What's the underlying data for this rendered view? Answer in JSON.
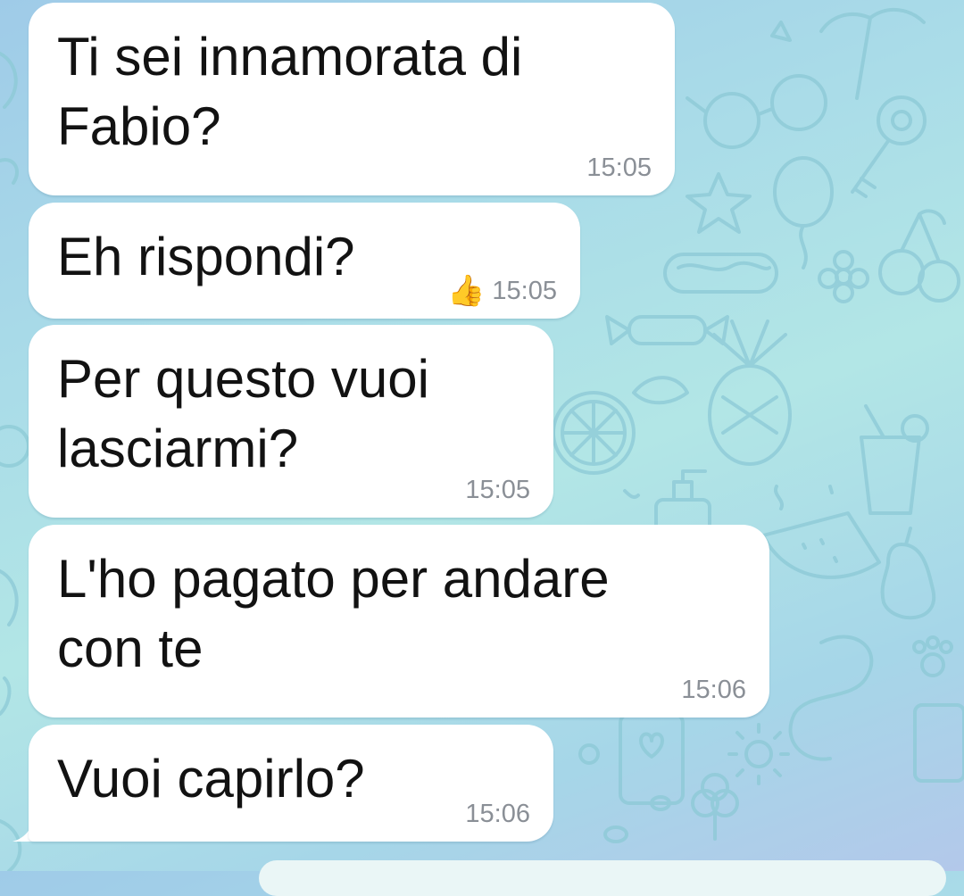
{
  "colors": {
    "bubble": "#ffffff",
    "timestamp": "#8a8f96",
    "text": "#121212",
    "wallpaper": "#a9dbe8"
  },
  "messages": [
    {
      "text": "Ti sei innamorata di\nFabio?",
      "time": "15:05"
    },
    {
      "text": "Eh rispondi?",
      "time": "15:05",
      "reaction": "👍",
      "reaction_icon": "thumbs-up-icon"
    },
    {
      "text": "Per questo vuoi\nlasciarmi?",
      "time": "15:05"
    },
    {
      "text": "L'ho pagato per andare\ncon te",
      "time": "15:06"
    },
    {
      "text": "Vuoi capirlo?",
      "time": "15:06"
    }
  ]
}
